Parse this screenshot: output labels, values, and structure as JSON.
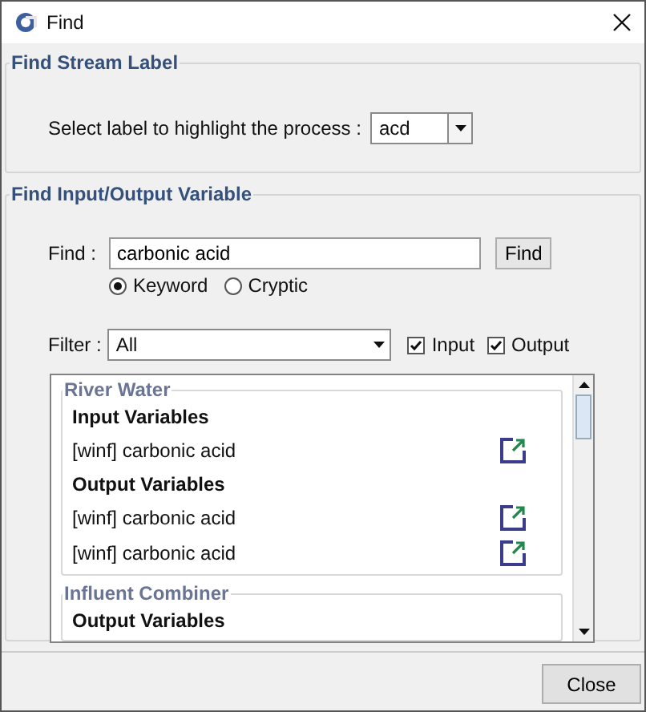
{
  "window": {
    "title": "Find"
  },
  "stream_label": {
    "title": "Find Stream Label",
    "label": "Select label to highlight the process :",
    "value": "acd"
  },
  "variable_search": {
    "title": "Find Input/Output Variable",
    "find_label": "Find :",
    "query": "carbonic acid",
    "find_button": "Find",
    "modes": [
      {
        "label": "Keyword",
        "selected": true
      },
      {
        "label": "Cryptic",
        "selected": false
      }
    ],
    "filter_label": "Filter :",
    "filter_value": "All",
    "checks": [
      {
        "label": "Input",
        "checked": true
      },
      {
        "label": "Output",
        "checked": true
      }
    ],
    "results": [
      {
        "title": "River Water",
        "groups": [
          {
            "heading": "Input Variables",
            "items": [
              "[winf] carbonic acid"
            ]
          },
          {
            "heading": "Output Variables",
            "items": [
              "[winf] carbonic acid",
              "[winf] carbonic acid"
            ]
          }
        ]
      },
      {
        "title": "Influent Combiner",
        "groups": [
          {
            "heading": "Output Variables"
          }
        ]
      }
    ]
  },
  "buttons": [
    "Close"
  ]
}
